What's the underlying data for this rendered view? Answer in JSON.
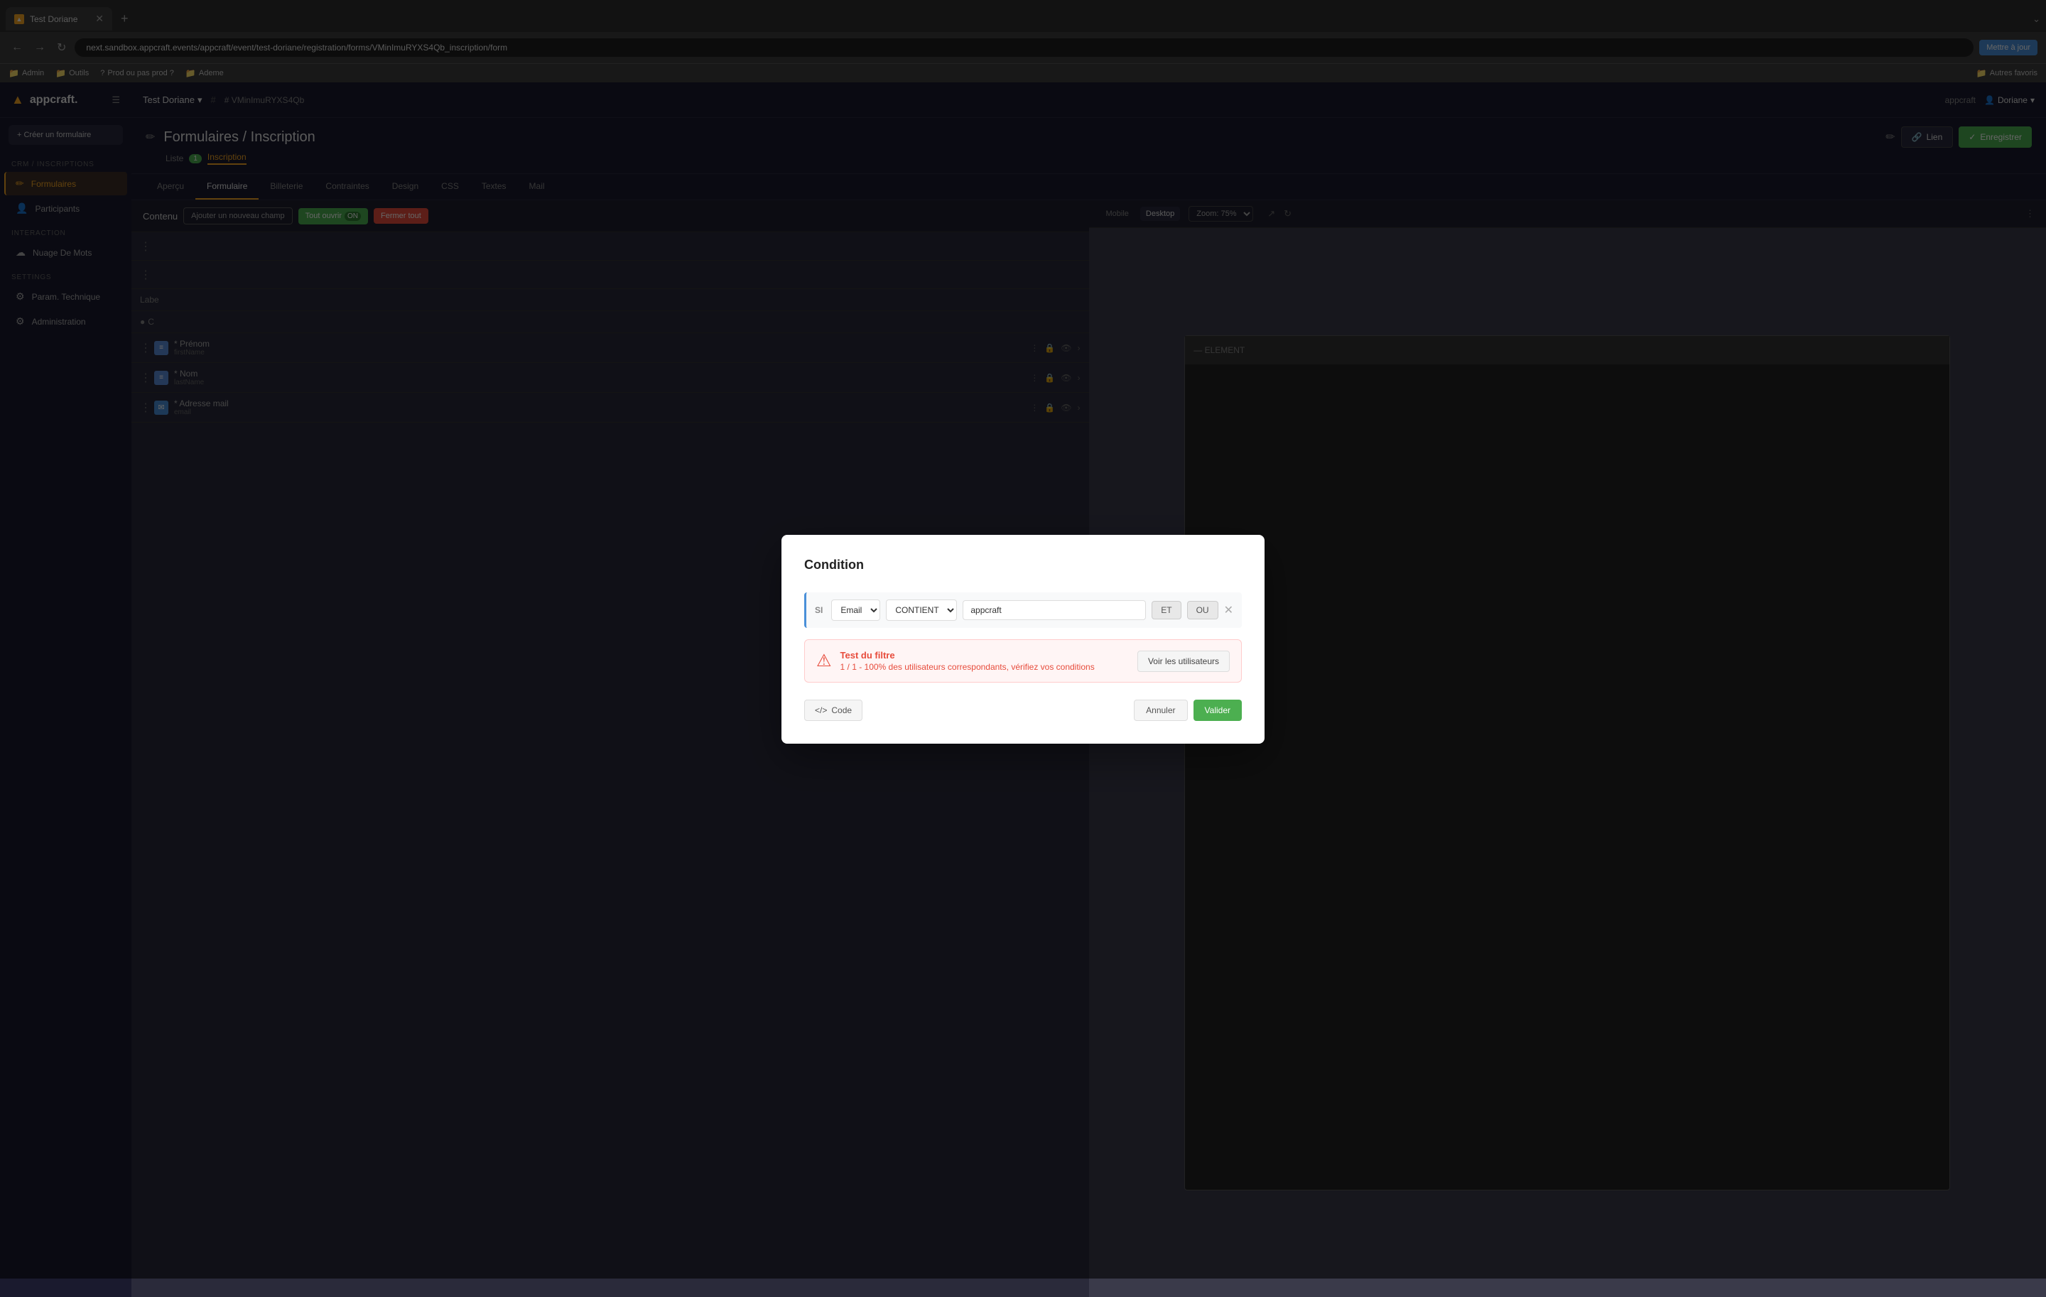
{
  "browser": {
    "tab_title": "Test Doriane",
    "tab_favicon": "▲",
    "address": "next.sandbox.appcraft.events/appcraft/event/test-doriane/registration/forms/VMinImuRYXS4Qb_inscription/form",
    "update_btn": "Mettre à jour",
    "bookmarks": [
      "Admin",
      "Outils",
      "Prod ou pas prod ?",
      "Ademe"
    ],
    "bookmarks_right": "Autres favoris"
  },
  "sidebar": {
    "logo": "appcraft.",
    "logo_icon": "▲",
    "new_btn": "+ Créer un formulaire",
    "sections": [
      {
        "label": "CRM / INSCRIPTIONS",
        "items": [
          {
            "icon": "✏",
            "label": "Formulaires",
            "active": true
          },
          {
            "icon": "👤",
            "label": "Participants",
            "active": false
          }
        ]
      },
      {
        "label": "INTERACTION",
        "items": [
          {
            "icon": "☁",
            "label": "Nuage De Mots",
            "active": false
          }
        ]
      },
      {
        "label": "SETTINGS",
        "items": [
          {
            "icon": "⚙",
            "label": "Param. Technique",
            "active": false
          },
          {
            "icon": "⚙",
            "label": "Administration",
            "active": false
          }
        ]
      }
    ]
  },
  "app_header": {
    "event_name": "Test Doriane",
    "event_id": "# VMinImuRYXS4Qb",
    "appcraft_label": "appcraft",
    "user_name": "Doriane"
  },
  "page_header": {
    "title": "Formulaires / Inscription",
    "sub_title_1": "Liste",
    "badge": "1",
    "sub_title_2": "Inscription",
    "btn_link": "Lien",
    "btn_save": "Enregistrer"
  },
  "tabs": [
    "Aperçu",
    "Formulaire",
    "Billeterie",
    "Contraintes",
    "Design",
    "CSS",
    "Textes",
    "Mail"
  ],
  "active_tab": "Formulaire",
  "sub_tabs": [
    "Liste",
    "Inscription"
  ],
  "content": {
    "title": "Contenu",
    "btn_add": "Ajouter un nouveau champ",
    "btn_open_all": "Tout ouvrir",
    "btn_close_all": "Fermer tout"
  },
  "right_panel": {
    "view_mobile": "Mobile",
    "view_desktop": "Desktop",
    "zoom_label": "Zoom: 75%"
  },
  "form_rows": [
    {
      "icon": "≡",
      "label": "* Prénom",
      "sublabel": "firstName"
    },
    {
      "icon": "≡",
      "label": "* Nom",
      "sublabel": "lastName"
    },
    {
      "icon": "✉",
      "label": "* Adresse mail",
      "sublabel": "email"
    }
  ],
  "modal": {
    "title": "Condition",
    "condition": {
      "si_label": "SI",
      "field_select": "Email",
      "operator_select": "CONTIENT",
      "value": "appcraft",
      "btn_et": "ET",
      "btn_ou": "OU"
    },
    "test_result": {
      "title": "Test du filtre",
      "detail": "1 / 1 - 100% des utilisateurs correspondants, vérifiez vos conditions",
      "btn_voir": "Voir les utilisateurs"
    },
    "btn_code": "Code",
    "btn_annuler": "Annuler",
    "btn_valider": "Valider"
  }
}
